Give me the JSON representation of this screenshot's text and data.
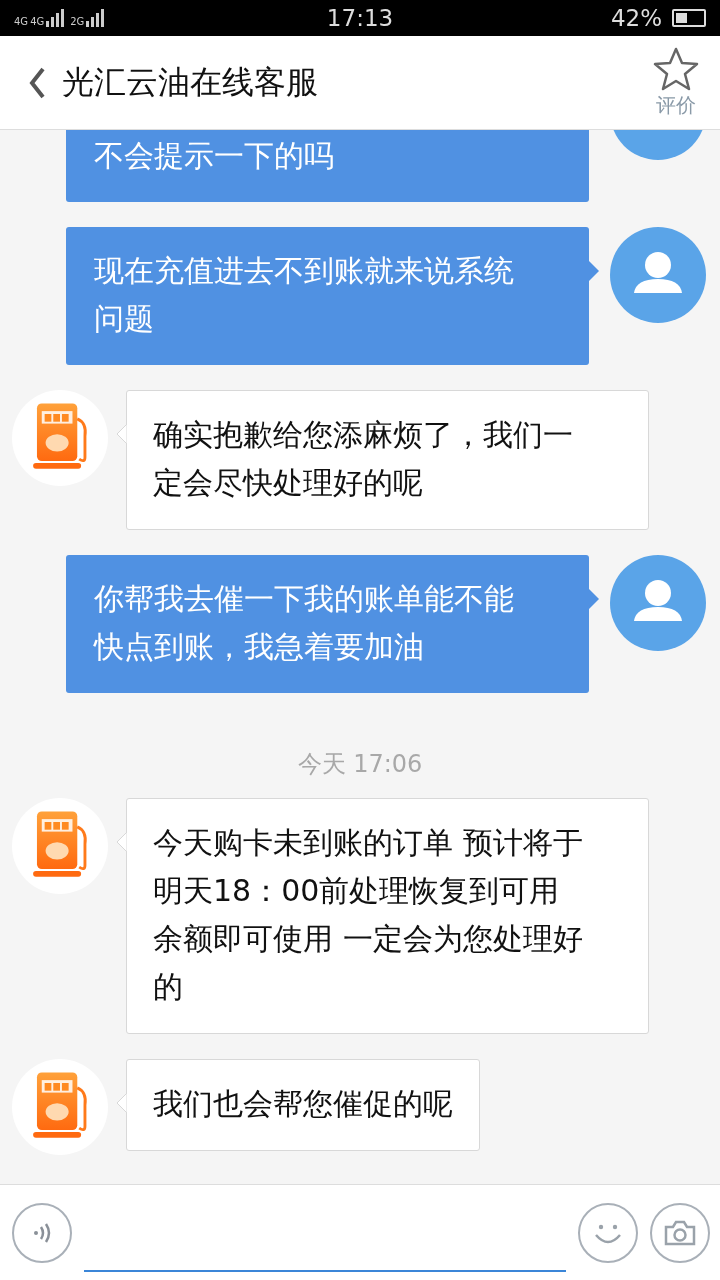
{
  "status_bar": {
    "networks": [
      "4G",
      "4G",
      "2G"
    ],
    "time": "17:13",
    "battery": "42%"
  },
  "header": {
    "title": "光汇云油在线客服",
    "rate_label": "评价"
  },
  "messages": [
    {
      "kind": "sent",
      "text": "不会提示一下的吗"
    },
    {
      "kind": "sent",
      "text": "现在充值进去不到账就来说系统问题"
    },
    {
      "kind": "received",
      "text": "确实抱歉给您添麻烦了，我们一定会尽快处理好的呢"
    },
    {
      "kind": "sent",
      "text": "你帮我去催一下我的账单能不能快点到账，我急着要加油"
    },
    {
      "kind": "time",
      "text": "今天 17:06"
    },
    {
      "kind": "received",
      "text": "今天购卡未到账的订单  预计将于明天18：00前处理恢复到可用余额即可使用  一定会为您处理好的"
    },
    {
      "kind": "received",
      "text": "我们也会帮您催促的呢"
    }
  ]
}
